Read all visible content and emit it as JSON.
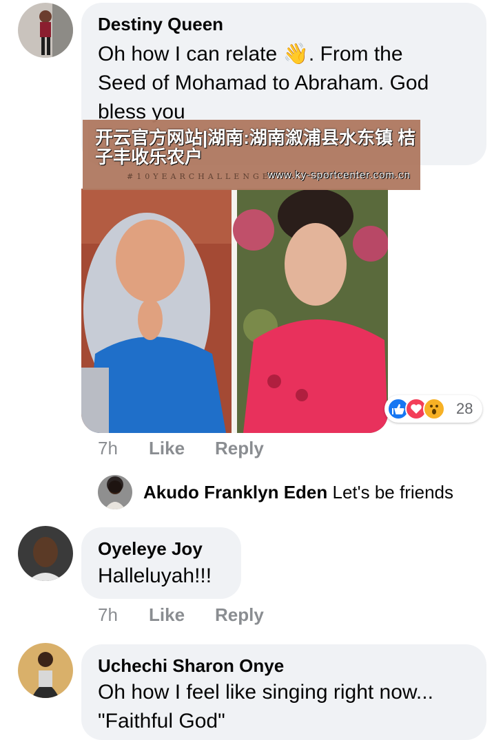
{
  "comments": [
    {
      "author": "Destiny Queen",
      "text_lines": [
        "Oh how I can relate 👋. From the",
        "Seed of Mohamad to Abraham. God",
        "bless you"
      ],
      "time": "7h",
      "like": "Like",
      "reply": "Reply",
      "reaction_count": "28"
    },
    {
      "author": "Oyeleye Joy",
      "text_lines": [
        "Halleluyah!!!"
      ],
      "time": "7h",
      "like": "Like",
      "reply": "Reply"
    },
    {
      "author": "Uchechi Sharon Onye",
      "text_lines": [
        "Oh how I feel like singing right now...",
        "\"Faithful God\""
      ]
    }
  ],
  "reply": {
    "author": "Akudo Franklyn Eden",
    "text": "Let's be friends"
  },
  "banner": {
    "title": "开云官方网站|湖南:湖南溆浦县水东镇 桔子丰收乐农户",
    "url": "www.ky-sportcenter.com.cn",
    "hashtag": "#10YEARCHALLENGE"
  },
  "icons": {
    "like_reaction": "thumbs-up-icon",
    "love_reaction": "heart-icon",
    "wow_reaction": "wow-face-icon"
  },
  "colors": {
    "bubble": "#f0f2f5",
    "meta": "#8a8d91",
    "like_blue": "#1877f2",
    "love_red": "#f33e58",
    "wow_yellow": "#f7b125",
    "banner": "#b07a62"
  }
}
